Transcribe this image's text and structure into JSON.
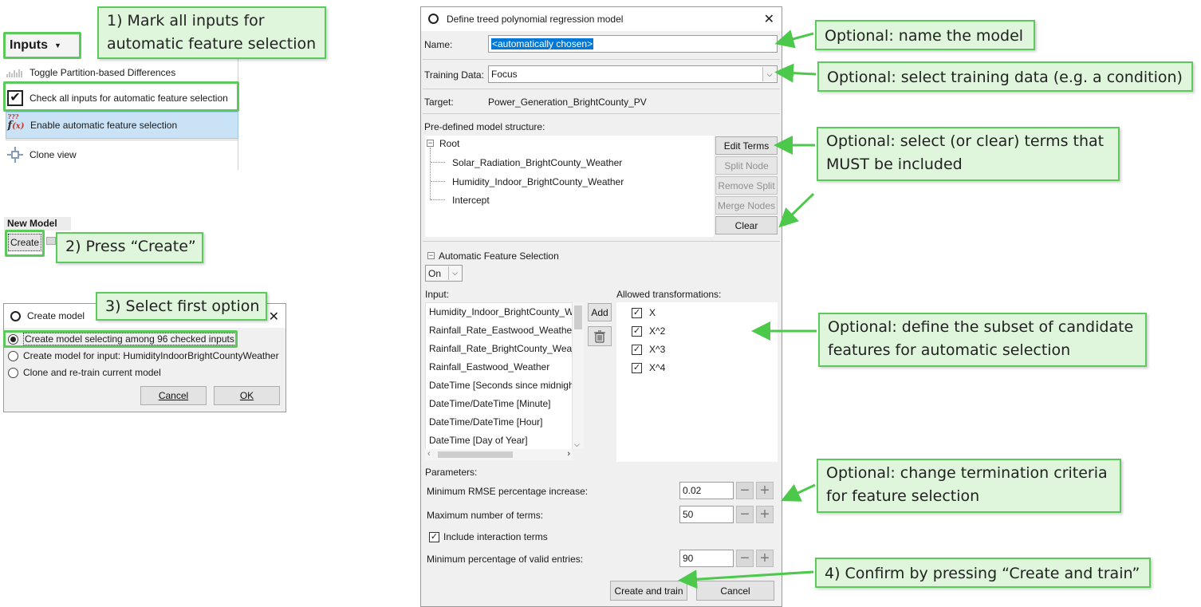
{
  "step1": {
    "text": "1) Mark all inputs for automatic feature selection",
    "line1": "1) Mark all inputs for",
    "line2": "automatic feature selection"
  },
  "step2": {
    "text": "2) Press “Create”"
  },
  "step3": {
    "text": "3) Select first option"
  },
  "step4": {
    "text": "4) Confirm by pressing “Create and train”"
  },
  "inputs_menu": {
    "label": "Inputs",
    "items": [
      {
        "label": "Toggle Partition-based Differences",
        "icon": "partition-icon"
      },
      {
        "label": "Check all inputs for automatic feature selection",
        "icon": "checkbox-icon"
      },
      {
        "label": "Enable automatic feature selection",
        "icon": "function-icon"
      },
      {
        "label": "Clone view",
        "icon": "clone-icon"
      }
    ]
  },
  "new_model": {
    "label": "New Model",
    "create_label": "Create"
  },
  "create_dialog": {
    "title": "Create model",
    "options": [
      "Create model selecting among 96 checked inputs",
      "Create model for input: HumidityIndoorBrightCountyWeather",
      "Clone and re-train current model"
    ],
    "cancel": "Cancel",
    "ok": "OK"
  },
  "main_dialog": {
    "title": "Define treed polynomial regression model",
    "name_label": "Name:",
    "name_value": "<automatically chosen>",
    "training_label": "Training Data:",
    "training_value": "Focus",
    "target_label": "Target:",
    "target_value": "Power_Generation_BrightCounty_PV",
    "structure_label": "Pre-defined model structure:",
    "tree_root": "Root",
    "tree_children": [
      "Solar_Radiation_BrightCounty_Weather",
      "Humidity_Indoor_BrightCounty_Weather",
      "Intercept"
    ],
    "btn_edit_terms": "Edit Terms",
    "btn_split_node": "Split Node",
    "btn_remove_split": "Remove Split",
    "btn_merge_nodes": "Merge Nodes",
    "btn_clear": "Clear",
    "afs_label": "Automatic Feature Selection",
    "afs_value": "On",
    "input_label": "Input:",
    "inputs": [
      "Humidity_Indoor_BrightCounty_W",
      "Rainfall_Rate_Eastwood_Weather",
      "Rainfall_Rate_BrightCounty_Weath",
      "Rainfall_Eastwood_Weather",
      "DateTime [Seconds since midnigh",
      "DateTime/DateTime [Minute]",
      "DateTime/DateTime [Hour]",
      "DateTime [Day of Year]"
    ],
    "add_label": "Add",
    "allowed_label": "Allowed transformations:",
    "transformations": [
      "X",
      "X^2",
      "X^3",
      "X^4"
    ],
    "params_label": "Parameters:",
    "param_rmse_label": "Minimum RMSE percentage increase:",
    "param_rmse_value": "0.02",
    "param_terms_label": "Maximum number of terms:",
    "param_terms_value": "50",
    "interaction_label": "Include interaction terms",
    "param_valid_label": "Minimum percentage of valid entries:",
    "param_valid_value": "90",
    "create_train": "Create and train",
    "cancel": "Cancel"
  },
  "notes": {
    "name": "Optional: name the model",
    "training": "Optional: select training data (e.g. a condition)",
    "terms_line1": "Optional: select (or clear) terms that",
    "terms_line2": "MUST be included",
    "features_line1": "Optional: define the subset of candidate",
    "features_line2": "features for automatic selection",
    "termination_line1": "Optional: change termination criteria",
    "termination_line2": "for feature selection"
  },
  "colors": {
    "callout_bg": "#dff5dc",
    "callout_border": "#5cc95b",
    "arrow": "#4cc94a",
    "selection": "#0078d7"
  }
}
